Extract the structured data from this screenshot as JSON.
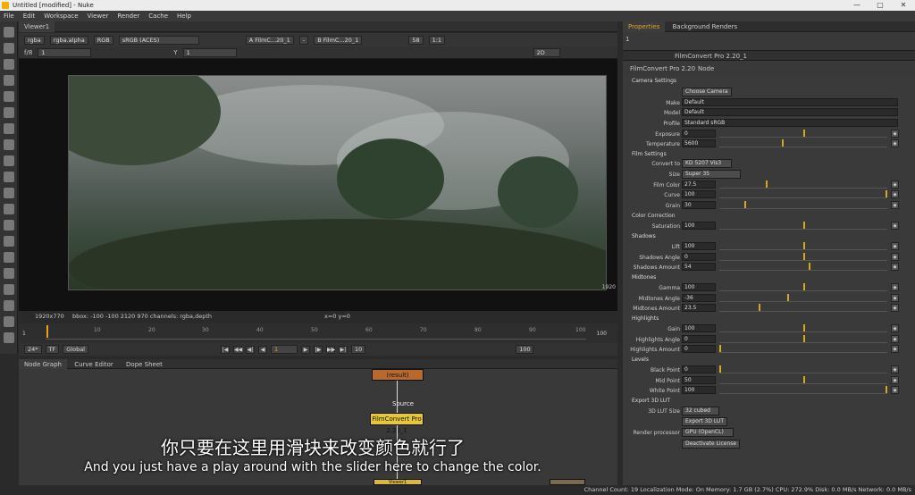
{
  "app": {
    "title": "Untitled [modified] - Nuke",
    "window_buttons": [
      "—",
      "▢",
      "✕"
    ]
  },
  "menu": [
    "File",
    "Edit",
    "Workspace",
    "Viewer",
    "Render",
    "Cache",
    "Help"
  ],
  "viewer": {
    "tab": "Viewer1",
    "channels": "rgba",
    "layer": "rgba.alpha",
    "display": "RGB",
    "colorspace": "sRGB (ACES)",
    "input_a": "A  FilmC...20_1",
    "dash": "-",
    "input_b": "B  FilmC...20_1",
    "zoom_val": "58",
    "zoom_ratio": "1:1",
    "fstop": "f/8",
    "frame_field": "1",
    "gamma_label": "Y",
    "gamma_val": "1",
    "view_mode": "2D",
    "right_edge": "1920",
    "format": "1920x770",
    "bbox": "bbox: -100 -100 2120 970 channels: rgba,depth",
    "coords": "x=0 y=0"
  },
  "timeline": {
    "start_left": "1",
    "end_right": "100",
    "ticks": [
      "1",
      "10",
      "20",
      "30",
      "40",
      "50",
      "60",
      "70",
      "80",
      "90",
      "100"
    ],
    "fps": "24*",
    "tf": "TF",
    "scope": "Global",
    "current_frame": "1",
    "step": "10",
    "end_field": "100"
  },
  "nodegraph": {
    "tabs": [
      "Node Graph",
      "Curve Editor",
      "Dope Sheet"
    ],
    "node_result": "(result)",
    "label_source": "Source",
    "node_film": "FilmConvert Pro 2.20_1",
    "node_viewer": "Viewer1"
  },
  "properties": {
    "tabs": [
      "Properties",
      "Background Renders"
    ],
    "count": "1",
    "node_name": "FilmConvert Pro 2.20_1",
    "subtabs": [
      "FilmConvert Pro 2.20",
      "Node"
    ],
    "camera_settings": "Camera Settings",
    "choose_camera": "Choose Camera",
    "make_label": "Make",
    "make": "Default",
    "model_label": "Model",
    "model": "Default",
    "profile_label": "Profile",
    "profile": "Standard sRGB",
    "exposure_label": "Exposure",
    "exposure": "0",
    "temperature_label": "Temperature",
    "temperature": "5600",
    "film_settings": "Film Settings",
    "convert_label": "Convert to",
    "convert": "KD 5207 Vis3",
    "size_label": "Size",
    "size": "Super 35",
    "film_color_label": "Film Color",
    "film_color": "27.5",
    "curve_label": "Curve",
    "curve": "100",
    "grain_label": "Grain",
    "grain": "30",
    "color_correction": "Color Correction",
    "saturation_label": "Saturation",
    "saturation": "100",
    "shadows": "Shadows",
    "lift_label": "Lift",
    "lift": "100",
    "shadows_angle_label": "Shadows Angle",
    "shadows_angle": "0",
    "shadows_amount_label": "Shadows Amount",
    "shadows_amount": "54",
    "midtones": "Midtones",
    "gamma_label": "Gamma",
    "gamma": "100",
    "mid_angle_label": "Midtones Angle",
    "mid_angle": "-36",
    "mid_amount_label": "Midtones Amount",
    "mid_amount": "23.5",
    "highlights": "Highlights",
    "gain_label": "Gain",
    "gain": "100",
    "hi_angle_label": "Highlights Angle",
    "hi_angle": "0",
    "hi_amount_label": "Highlights Amount",
    "hi_amount": "0",
    "levels": "Levels",
    "black_label": "Black Point",
    "black": "0",
    "mid_label": "Mid Point",
    "mid": "50",
    "white_label": "White Point",
    "white": "100",
    "export_lut": "Export 3D LUT",
    "lut_size_label": "3D LUT Size",
    "lut_size": "32 cubed",
    "export_btn": "Export 3D LUT",
    "render_label": "Render processor",
    "render": "GPU (OpenCL)",
    "deactivate": "Deactivate License"
  },
  "status": "Channel Count: 19  Localization Mode: On  Memory: 1.7 GB (2.7%)  CPU: 272.9%  Disk: 0.0 MB/s  Network: 0.0 MB/s",
  "subtitle": {
    "cn": "你只要在这里用滑块来改变颜色就行了",
    "en": "And you just have a play around with the slider here to change the color."
  },
  "colors": {
    "accent": "#d8a81c",
    "node_result": "#b86a2e",
    "node_film": "#e8c830"
  }
}
